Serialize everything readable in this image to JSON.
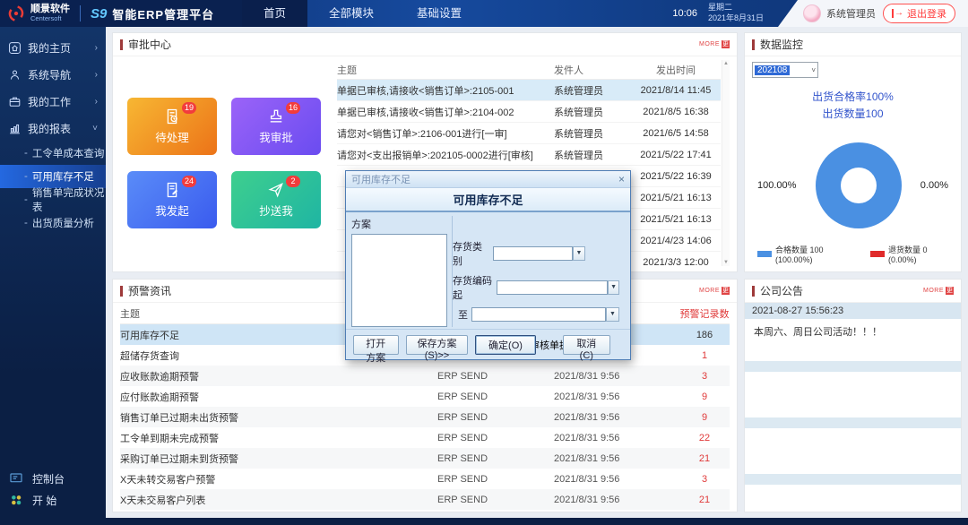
{
  "topbar": {
    "logo_cn": "顺景软件",
    "logo_en": "Centersoft",
    "logo_s9": "S9",
    "product": "智能ERP管理平台",
    "nav": [
      {
        "label": "首页",
        "active": true
      },
      {
        "label": "全部模块"
      },
      {
        "label": "基础设置"
      }
    ],
    "time": "10:06",
    "weekday": "星期二",
    "date": "2021年8月31日",
    "user": "系统管理员",
    "logout": "退出登录"
  },
  "sidebar": {
    "items": [
      {
        "label": "我的主页",
        "chevron": "›"
      },
      {
        "label": "系统导航",
        "chevron": "›"
      },
      {
        "label": "我的工作",
        "chevron": "›"
      },
      {
        "label": "我的报表",
        "chevron": "˅"
      }
    ],
    "submenu": [
      {
        "label": "工令单成本查询"
      },
      {
        "label": "可用库存不足",
        "active": true
      },
      {
        "label": "销售单完成状况表"
      },
      {
        "label": "出货质量分析"
      }
    ],
    "console": "控制台",
    "start": "开 始"
  },
  "more_badge": {
    "text": "MORE",
    "box": "更"
  },
  "approval": {
    "title": "审批中心",
    "tiles": [
      {
        "label": "待处理",
        "count": "19"
      },
      {
        "label": "我审批",
        "count": "16"
      },
      {
        "label": "我发起",
        "count": "24"
      },
      {
        "label": "抄送我",
        "count": "2"
      }
    ],
    "columns": {
      "subject": "主题",
      "sender": "发件人",
      "time": "发出时间"
    },
    "rows": [
      {
        "subject": "单据已审核,请接收<销售订单>:2105-001",
        "sender": "系统管理员",
        "time": "2021/8/14 11:45",
        "highlight": true
      },
      {
        "subject": "单据已审核,请接收<销售订单>:2104-002",
        "sender": "系统管理员",
        "time": "2021/8/5 16:38"
      },
      {
        "subject": "请您对<销售订单>:2106-001进行[一审]",
        "sender": "系统管理员",
        "time": "2021/6/5 14:58"
      },
      {
        "subject": "请您对<支出报销单>:202105-0002进行[审核]",
        "sender": "系统管理员",
        "time": "2021/5/22 17:41"
      },
      {
        "subject": "",
        "sender": "系统管理员",
        "time": "2021/5/22 16:39"
      },
      {
        "subject": "",
        "sender": "系统管理员",
        "time": "2021/5/21 16:13"
      },
      {
        "subject": "",
        "sender": "系统管理员",
        "time": "2021/5/21 16:13"
      },
      {
        "subject": "",
        "sender": "系统管理员",
        "time": "2021/4/23 14:06"
      },
      {
        "subject": "",
        "sender": "系统管理员",
        "time": "2021/3/3 12:00"
      }
    ]
  },
  "alerts": {
    "title": "预警资讯",
    "columns": {
      "subject": "主题",
      "count": "预警记录数"
    },
    "rows": [
      {
        "subject": "可用库存不足",
        "sender": "ERP SEND",
        "time": "2021/8/31 9:56",
        "count": "186",
        "dark": true,
        "highlight": true
      },
      {
        "subject": "超储存货查询",
        "sender": "ERP SEND",
        "time": "2021/8/31 9:56",
        "count": "1"
      },
      {
        "subject": "应收账款逾期预警",
        "sender": "ERP SEND",
        "time": "2021/8/31 9:56",
        "count": "3"
      },
      {
        "subject": "应付账款逾期预警",
        "sender": "ERP SEND",
        "time": "2021/8/31 9:56",
        "count": "9"
      },
      {
        "subject": "销售订单已过期未出货预警",
        "sender": "ERP SEND",
        "time": "2021/8/31 9:56",
        "count": "9"
      },
      {
        "subject": "工令单到期未完成预警",
        "sender": "ERP SEND",
        "time": "2021/8/31 9:56",
        "count": "22"
      },
      {
        "subject": "采购订单已过期未到货预警",
        "sender": "ERP SEND",
        "time": "2021/8/31 9:56",
        "count": "21"
      },
      {
        "subject": "X天未转交易客户预警",
        "sender": "ERP SEND",
        "time": "2021/8/31 9:56",
        "count": "3"
      },
      {
        "subject": "X天未交易客户列表",
        "sender": "ERP SEND",
        "time": "2021/8/31 9:56",
        "count": "21"
      }
    ]
  },
  "monitor": {
    "title": "数据监控",
    "period": "202108",
    "rate_line": "出货合格率100%",
    "qty_line": "出货数量100",
    "left_label": "100.00%",
    "right_label": "0.00%",
    "legend": [
      {
        "label": "合格数量 100 (100.00%)",
        "color": "#4a90e2"
      },
      {
        "label": "退货数量 0 (0.00%)",
        "color": "#e02b2b"
      }
    ],
    "chart": {
      "type": "donut",
      "slices": [
        {
          "name": "合格数量",
          "value": 100,
          "pct": "100.00%"
        },
        {
          "name": "退货数量",
          "value": 0,
          "pct": "0.00%"
        }
      ]
    }
  },
  "notice": {
    "title": "公司公告",
    "date": "2021-08-27 15:56:23",
    "content": "本周六、周日公司活动！！！"
  },
  "modal": {
    "title": "可用库存不足",
    "heading": "可用库存不足",
    "scheme_label": "方案",
    "fields": [
      {
        "label": "存货类别"
      },
      {
        "label": "存货编码起"
      },
      {
        "label": "至"
      }
    ],
    "combo_arrow": "▼",
    "checkbox_label": "未审核单据参与计算",
    "buttons": {
      "open": "打开方案",
      "save": "保存方案(S)>>",
      "ok": "确定(O)",
      "cancel": "取消(C)"
    },
    "close": "×"
  },
  "scroll": {
    "up": "▲",
    "down": "▼"
  }
}
